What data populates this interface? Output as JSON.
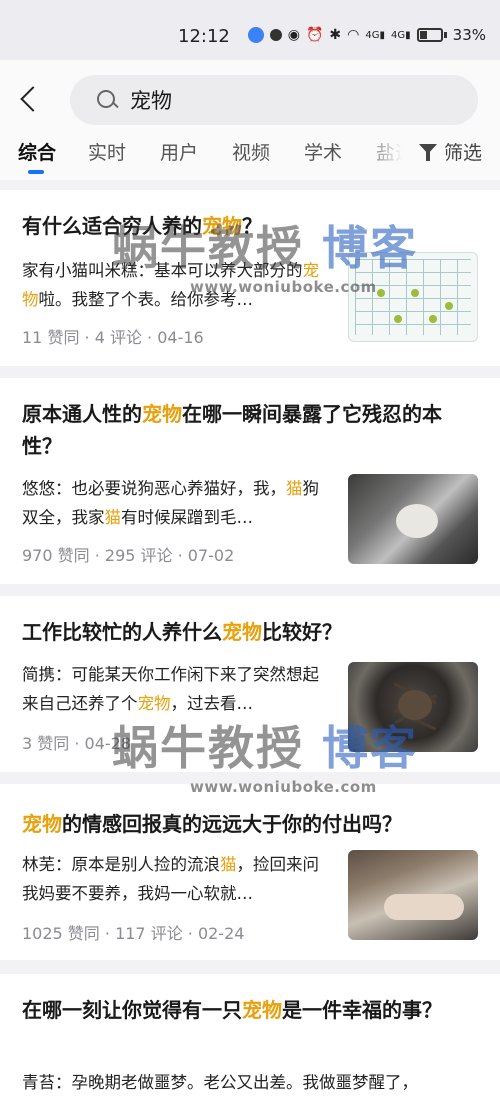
{
  "status_bar": {
    "time": "12:12",
    "battery": "33%",
    "icons": [
      "shield-icon",
      "hd-icon",
      "eye-icon",
      "alarm-icon",
      "bluetooth-icon",
      "wifi-icon",
      "signal-4g-icon",
      "signal-5g-icon",
      "battery-icon"
    ],
    "network_labels": [
      "4G",
      "4G"
    ]
  },
  "search": {
    "query": "宠物"
  },
  "tabs": [
    {
      "label": "综合",
      "active": true
    },
    {
      "label": "实时"
    },
    {
      "label": "用户"
    },
    {
      "label": "视频"
    },
    {
      "label": "学术"
    },
    {
      "label": "盐选"
    }
  ],
  "filter_label": "筛选",
  "results": [
    {
      "title_parts": [
        "有什么适合穷人养的",
        "宠物",
        "？"
      ],
      "excerpt_parts": [
        "家有小猫叫米糕：基本可以养大部分的",
        "宠物",
        "啦。我整了个表。给你参考…"
      ],
      "meta": "11 赞同 · 4 评论 · 04-16",
      "thumb": "pet-table-image"
    },
    {
      "title_parts": [
        "原本通人性的",
        "宠物",
        "在哪一瞬间暴露了它残忍的本性？"
      ],
      "excerpt_parts": [
        "悠悠：也必要说狗恶心养猫好，我，",
        "猫",
        "狗双全，我家",
        "猫",
        "有时候屎蹭到毛…"
      ],
      "meta": "970 赞同 · 295 评论 · 07-02",
      "thumb": "cat-image"
    },
    {
      "title_parts": [
        "工作比较忙的人养什么",
        "宠物",
        "比较好？"
      ],
      "excerpt_parts": [
        "简携：可能某天你工作闲下来了突然想起来自己还养了个",
        "宠物",
        "，过去看…"
      ],
      "meta": "3 赞同 · 04-28",
      "thumb": "tarantula-image"
    },
    {
      "title_parts": [
        "",
        "宠物",
        "的情感回报真的远远大于你的付出吗？"
      ],
      "excerpt_parts": [
        "林芜：原本是别人捡的流浪",
        "猫",
        "，捡回来问我妈要不要养，我妈一心软就…"
      ],
      "meta": "1025 赞同 · 117 评论 · 02-24",
      "thumb": "cat-hand-image"
    },
    {
      "title_parts": [
        "在哪一刻让你觉得有一只",
        "宠物",
        "是一件幸福的事？"
      ],
      "excerpt_parts": [
        "青苔：孕晚期老做噩梦。老公又出差。我做噩梦醒了，"
      ]
    }
  ],
  "watermark": {
    "brand": "蜗牛教授",
    "blog": "博客",
    "url": "www.woniuboke.com"
  },
  "colors": {
    "highlight": "#e8a00d",
    "tab_indicator": "#1772f6",
    "meta_text": "#8b8b92"
  }
}
